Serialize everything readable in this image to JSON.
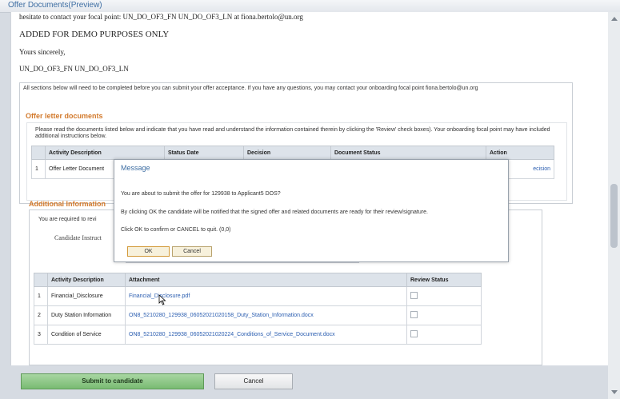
{
  "window": {
    "title": "Offer Documents(Preview)"
  },
  "letter": {
    "contact_line": "hesitate to contact your focal point: UN_DO_OF3_FN UN_DO_OF3_LN at fiona.bertolo@un.org",
    "demo_notice": "ADDED FOR DEMO PURPOSES ONLY",
    "closing": "Yours sincerely,",
    "signatory": "UN_DO_OF3_FN UN_DO_OF3_LN"
  },
  "intro_text": "All sections below will need to be completed before you can submit your offer acceptance. If you have any questions, you may contact your onboarding focal point fiona.bertolo@un.org",
  "offer_section": {
    "title": "Offer letter documents",
    "instructions": "Please read the documents listed below and indicate that you have read and understand the information contained therein by clicking the 'Review' check boxes). Your onboarding focal point may have included additional instructions below.",
    "columns": [
      "Activity Description",
      "Status Date",
      "Decision",
      "Document Status",
      "Action"
    ],
    "rows": [
      {
        "num": "1",
        "activity": "Offer Letter Document",
        "action": "ecision"
      }
    ]
  },
  "additional_section": {
    "title": "Additional Information",
    "required_text": "You are required to revi",
    "candidate_instructions_label": "Candidate Instruct",
    "columns": [
      "Activity Description",
      "Attachment",
      "Review Status"
    ],
    "rows": [
      {
        "num": "1",
        "activity": "Financial_Disclosure",
        "attachment": "Financial_Disclosure.pdf"
      },
      {
        "num": "2",
        "activity": "Duty Station Information",
        "attachment": "ON8_5210280_129938_06052021020158_Duty_Station_Information.docx"
      },
      {
        "num": "3",
        "activity": "Condition of Service",
        "attachment": "ON8_5210280_129938_06052021020224_Conditions_of_Service_Document.docx"
      }
    ]
  },
  "modal": {
    "title": "Message",
    "line1": "You are about to submit the offer for 129938 to Applicant5 DOS?",
    "line2": "By clicking OK the candidate will be notified that the signed offer and related documents are ready for their review/signature.",
    "line3": "Click OK to confirm or CANCEL to quit. (0,0)",
    "ok_label": "OK",
    "cancel_label": "Cancel"
  },
  "footer": {
    "submit_label": "Submit to candidate",
    "cancel_label": "Cancel"
  },
  "colors": {
    "section_title": "#d2792b",
    "link": "#2a5db0",
    "submit_green": "#79bb72"
  }
}
